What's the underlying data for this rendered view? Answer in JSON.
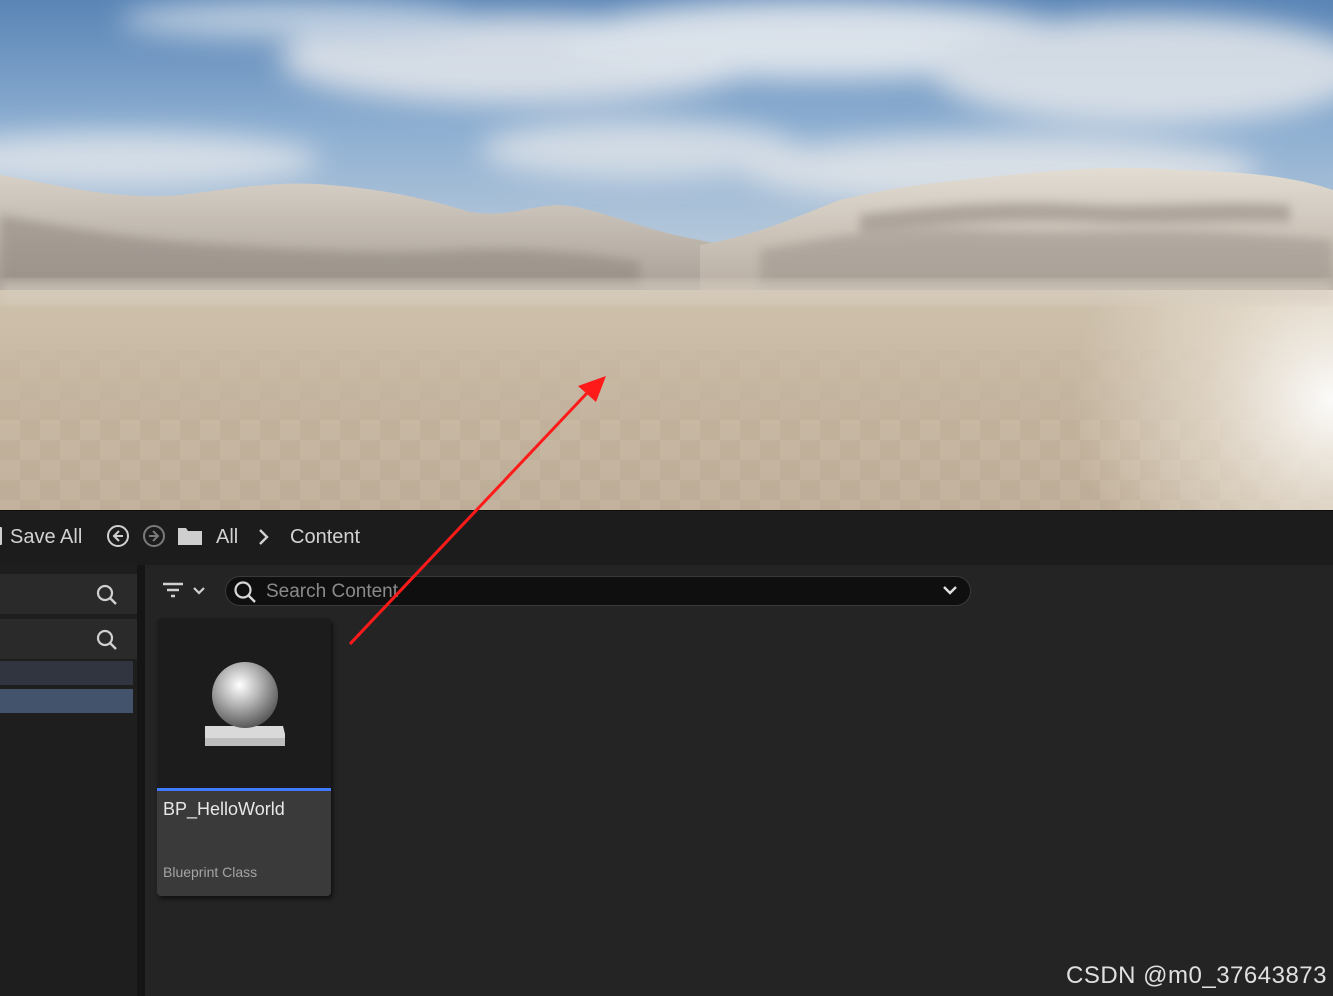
{
  "toolbar": {
    "save_all_label": "Save All",
    "breadcrumb": {
      "root_label": "All",
      "current_label": "Content"
    }
  },
  "content_browser": {
    "search": {
      "placeholder": "Search Content"
    },
    "assets": [
      {
        "name": "BP_HelloWorld",
        "type": "Blueprint Class",
        "icon": "blueprint-sphere-icon"
      }
    ]
  },
  "colors": {
    "selection_accent": "#3e7bff",
    "annotation_arrow": "#ff1a1a"
  },
  "watermark": "CSDN @m0_37643873"
}
